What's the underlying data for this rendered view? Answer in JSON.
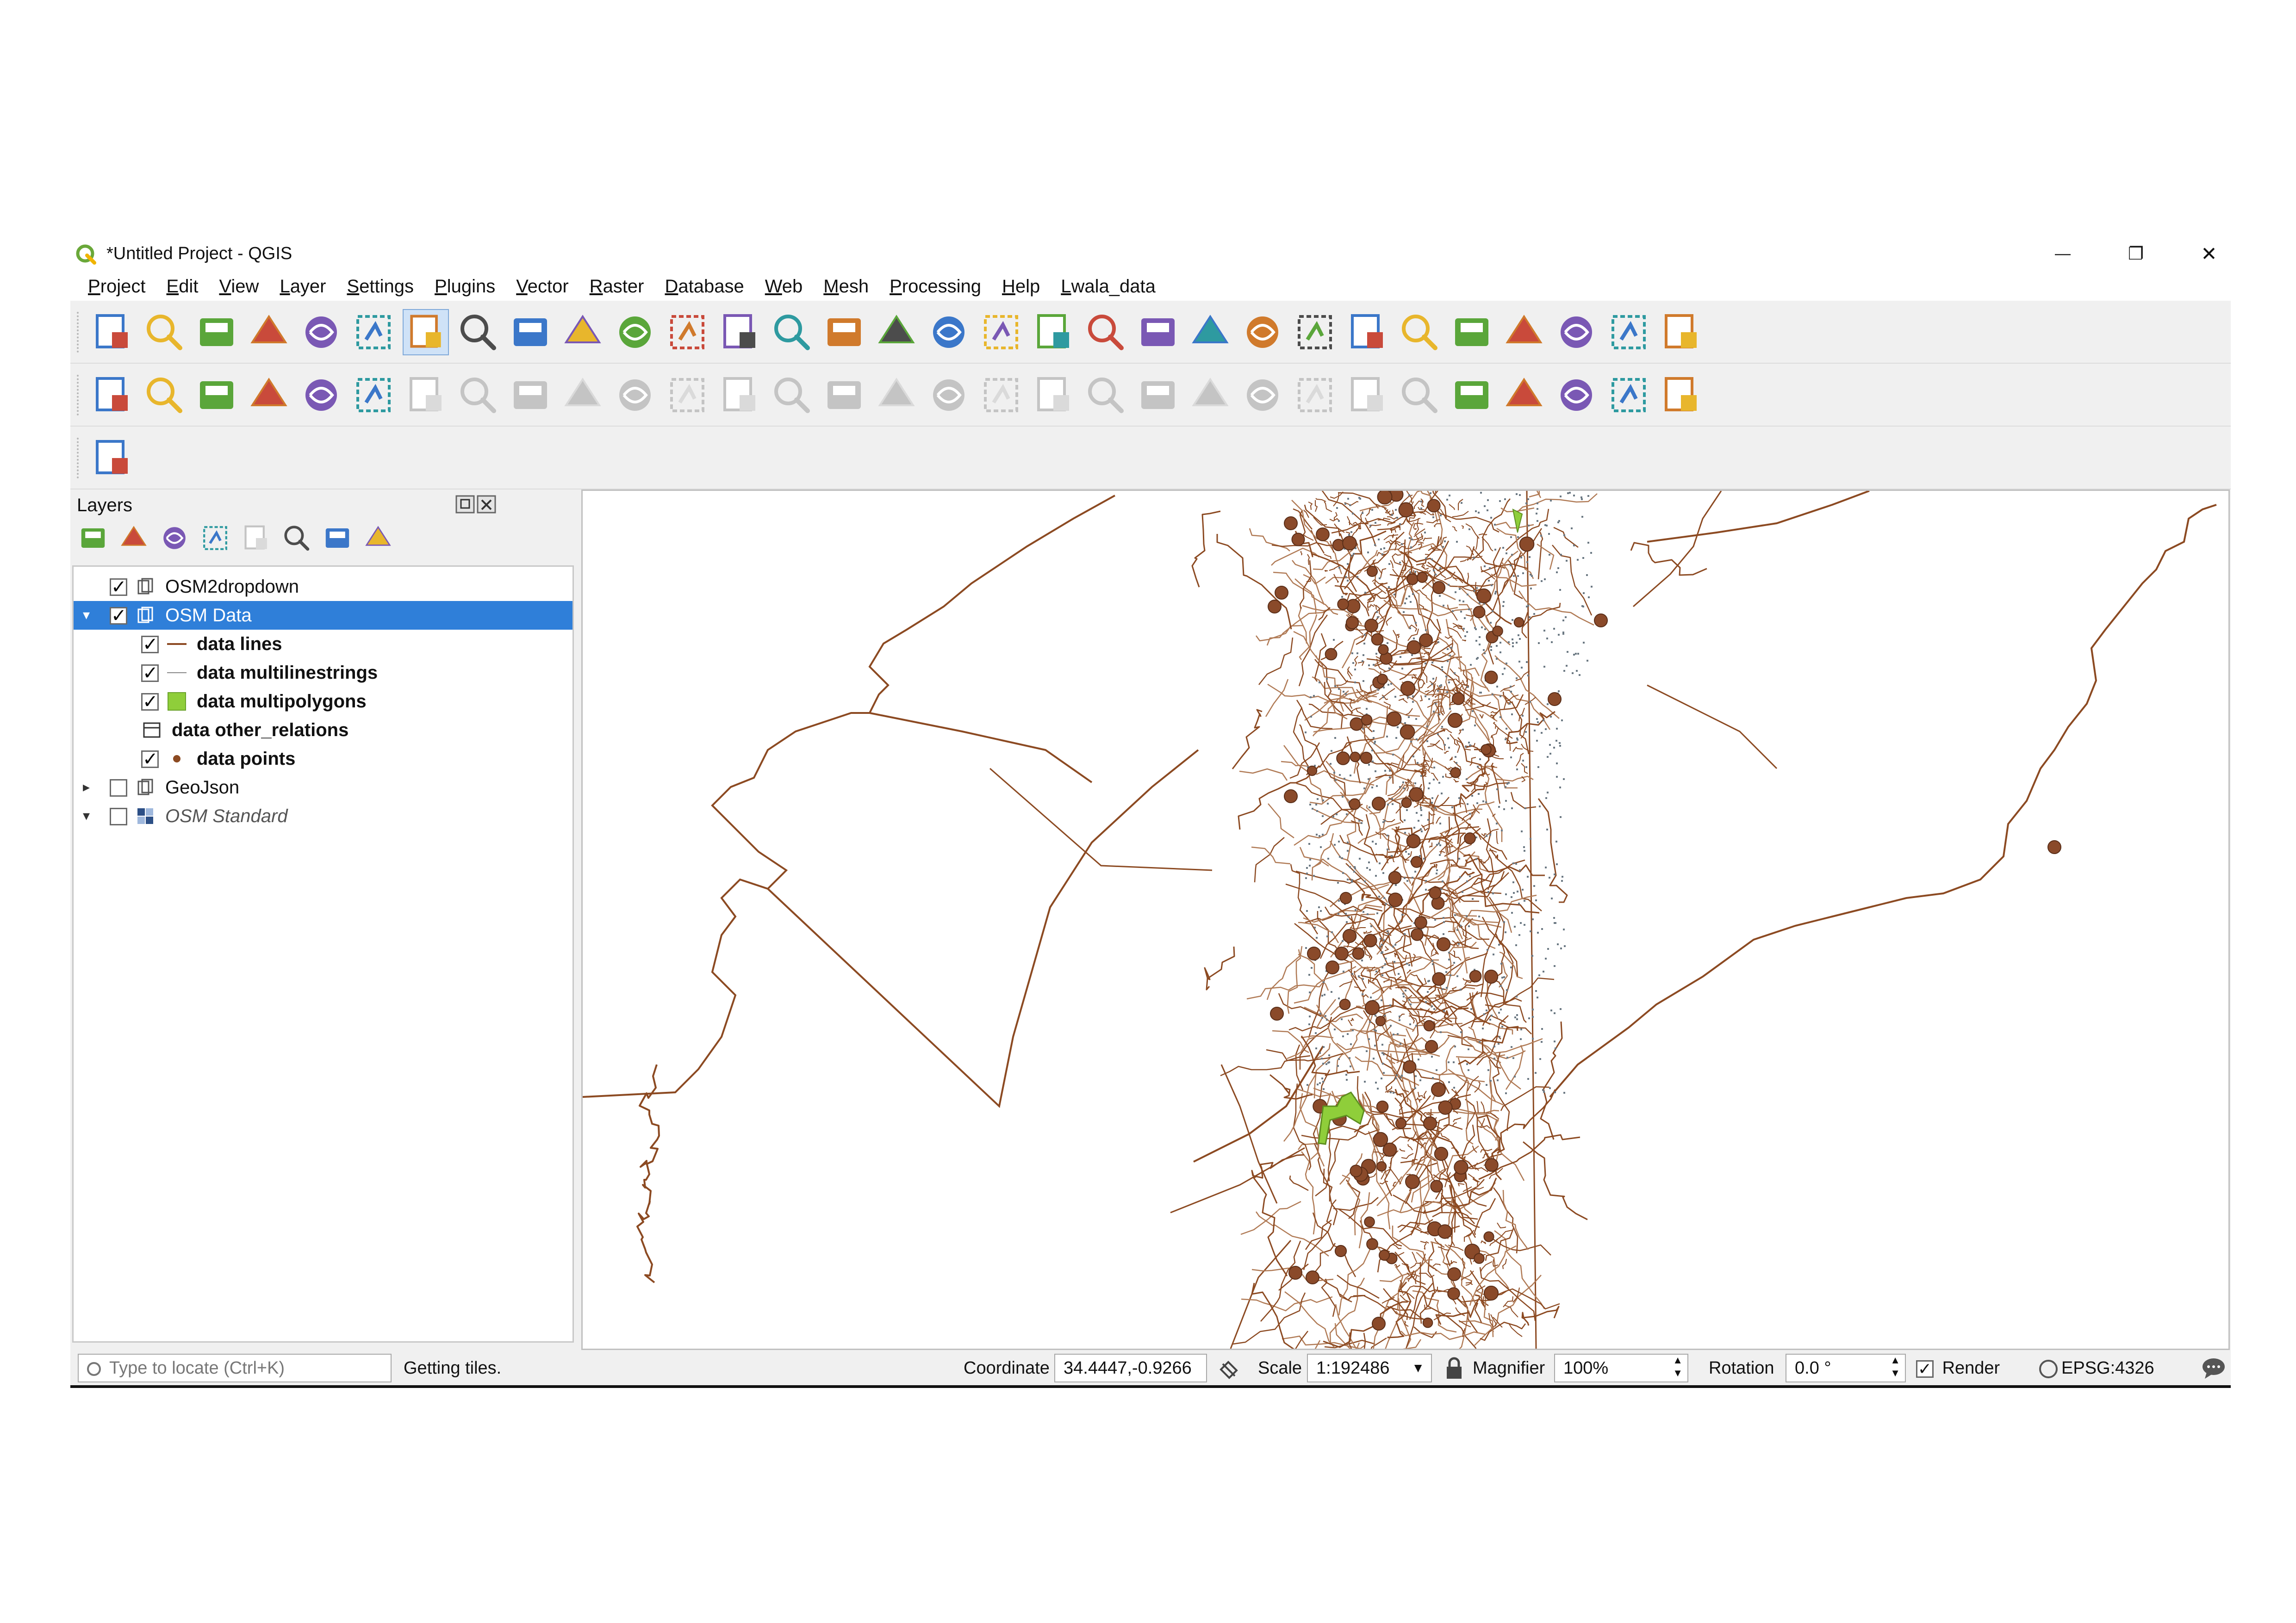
{
  "window": {
    "title": "*Untitled Project - QGIS",
    "minimize_glyph": "—",
    "restore_glyph": "❐",
    "close_glyph": "✕"
  },
  "menu": [
    "Project",
    "Edit",
    "View",
    "Layer",
    "Settings",
    "Plugins",
    "Vector",
    "Raster",
    "Database",
    "Web",
    "Mesh",
    "Processing",
    "Help",
    "Lwala_data"
  ],
  "toolbars": {
    "row1": [
      "new-project-icon",
      "open-project-icon",
      "save-project-icon",
      "save-as-icon",
      "print-layout-icon",
      "style-manager-icon",
      "pan-icon",
      "pan-to-selection-icon",
      "zoom-in-icon",
      "zoom-out-icon",
      "zoom-native-icon",
      "zoom-full-icon",
      "zoom-to-selection-icon",
      "zoom-to-layer-icon",
      "zoom-last-icon",
      "zoom-next-icon",
      "new-map-view-icon",
      "new-bookmark-icon",
      "show-bookmarks-icon",
      "refresh-icon",
      "identify-icon",
      "select-features-icon",
      "select-rectangle-icon",
      "deselect-icon",
      "attribute-table-icon",
      "field-calculator-icon",
      "processing-toolbox-icon",
      "statistics-icon",
      "measure-icon",
      "map-tips-icon",
      "text-annotation-icon"
    ],
    "row2": [
      "data-source-manager-icon",
      "new-geopackage-icon",
      "add-vector-icon",
      "add-csv-icon",
      "add-spatialite-icon",
      "virtual-layer-icon",
      "digitize-icon",
      "toggle-editing-icon",
      "save-edits-icon",
      "add-feature-icon",
      "vertex-tool-icon",
      "modify-attributes-icon",
      "delete-selected-icon",
      "cut-features-icon",
      "copy-features-icon",
      "paste-features-icon",
      "undo-icon",
      "redo-icon",
      "label-toolbar-icon",
      "layer-diagram-icon",
      "highlight-label-icon",
      "pin-labels-icon",
      "show-hide-labels-icon",
      "move-label-icon",
      "rotate-label-icon",
      "change-label-icon",
      "osm-place-search-icon",
      "osm-download-icon",
      "quickosm-icon",
      "python-console-icon",
      "help-icon"
    ],
    "row3": [
      "select-by-location-icon"
    ]
  },
  "layers_panel": {
    "title": "Layers",
    "tools": [
      "open-styling-icon",
      "add-group-icon",
      "manage-visibility-icon",
      "filter-legend-icon",
      "filter-expression-icon",
      "expand-all-icon",
      "collapse-all-icon",
      "remove-layer-icon"
    ],
    "items": [
      {
        "label": "OSM2dropdown",
        "checked": true,
        "bold": false,
        "selected": false,
        "indent": 0,
        "expander": "",
        "icon": "group-icon"
      },
      {
        "label": "OSM Data",
        "checked": true,
        "bold": false,
        "selected": true,
        "indent": 0,
        "expander": "▾",
        "icon": "group-icon"
      },
      {
        "label": "data lines",
        "checked": true,
        "bold": true,
        "selected": false,
        "indent": 1,
        "expander": "",
        "icon": "line-symbol-icon"
      },
      {
        "label": "data multilinestrings",
        "checked": true,
        "bold": true,
        "selected": false,
        "indent": 1,
        "expander": "",
        "icon": "thin-line-symbol-icon"
      },
      {
        "label": "data multipolygons",
        "checked": true,
        "bold": true,
        "selected": false,
        "indent": 1,
        "expander": "",
        "icon": "polygon-symbol-icon"
      },
      {
        "label": "data other_relations",
        "checked": null,
        "bold": true,
        "selected": false,
        "indent": 1,
        "expander": "",
        "icon": "table-layer-icon"
      },
      {
        "label": "data points",
        "checked": true,
        "bold": true,
        "selected": false,
        "indent": 1,
        "expander": "",
        "icon": "point-symbol-icon"
      },
      {
        "label": "GeoJson",
        "checked": false,
        "bold": false,
        "selected": false,
        "indent": 0,
        "expander": "▸",
        "icon": "group-icon"
      },
      {
        "label": "OSM Standard",
        "checked": false,
        "bold": false,
        "italic": true,
        "selected": false,
        "indent": 0,
        "expander": "▾",
        "icon": "raster-tile-icon"
      }
    ]
  },
  "statusbar": {
    "locator_placeholder": "Type to locate (Ctrl+K)",
    "message": "Getting tiles.",
    "coordinate_label": "Coordinate",
    "coordinate_value": "34.4447,-0.9266",
    "scale_label": "Scale",
    "scale_value": "1:192486",
    "magnifier_label": "Magnifier",
    "magnifier_value": "100%",
    "rotation_label": "Rotation",
    "rotation_value": "0.0 °",
    "render_label": "Render",
    "render_checked": true,
    "crs": "EPSG:4326"
  },
  "colors": {
    "feature": "#8c4a22",
    "feature_light": "#b07a55",
    "polygon_fill": "#8fce3a",
    "selection": "#2f7fd9"
  }
}
